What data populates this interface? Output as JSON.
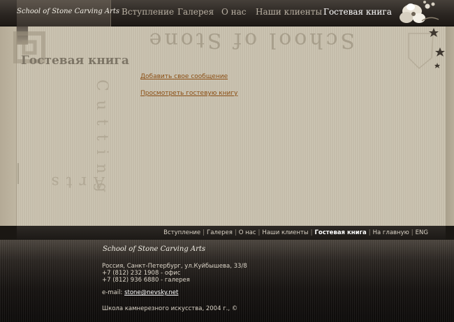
{
  "header": {
    "logo": "School of Stone Carving Arts",
    "nav": [
      {
        "label": "Вступление",
        "active": false
      },
      {
        "label": "Галерея",
        "active": false
      },
      {
        "label": "О нас",
        "active": false
      },
      {
        "label": "Наши клиенты",
        "active": false
      },
      {
        "label": "Гостевая книга",
        "active": true
      }
    ]
  },
  "watermark": {
    "top_text": "School of Stone",
    "vertical_text": "Cutting",
    "bottom_text": "Arts"
  },
  "main": {
    "title": "Гостевая книга",
    "links": [
      {
        "label": "Добавить свое сообщение"
      },
      {
        "label": "Просмотреть гостевую книгу"
      }
    ]
  },
  "bottom_nav": {
    "items": [
      {
        "label": "Вступление",
        "active": false
      },
      {
        "label": "Галерея",
        "active": false
      },
      {
        "label": "О нас",
        "active": false
      },
      {
        "label": "Наши клиенты",
        "active": false
      },
      {
        "label": "Гостевая книга",
        "active": true
      },
      {
        "label": "На главную",
        "active": false
      },
      {
        "label": "ENG",
        "active": false
      }
    ],
    "separator": "|"
  },
  "footer": {
    "logo": "School of Stone Carving Arts",
    "address": "Россия, Санкт-Петербург, ул.Куйбышева, 33/8",
    "phone_office": "+7 (812) 232 1908 - офис",
    "phone_gallery": "+7 (812) 936 6880 - галерея",
    "email_label": "e-mail:",
    "email": "stone@nevsky.net",
    "copyright": "Школа камнерезного искусства, 2004 г., ©"
  },
  "colors": {
    "accent_link": "#8a4d12",
    "background_main": "#c8c0ad",
    "header_dark": "#2b2622"
  }
}
